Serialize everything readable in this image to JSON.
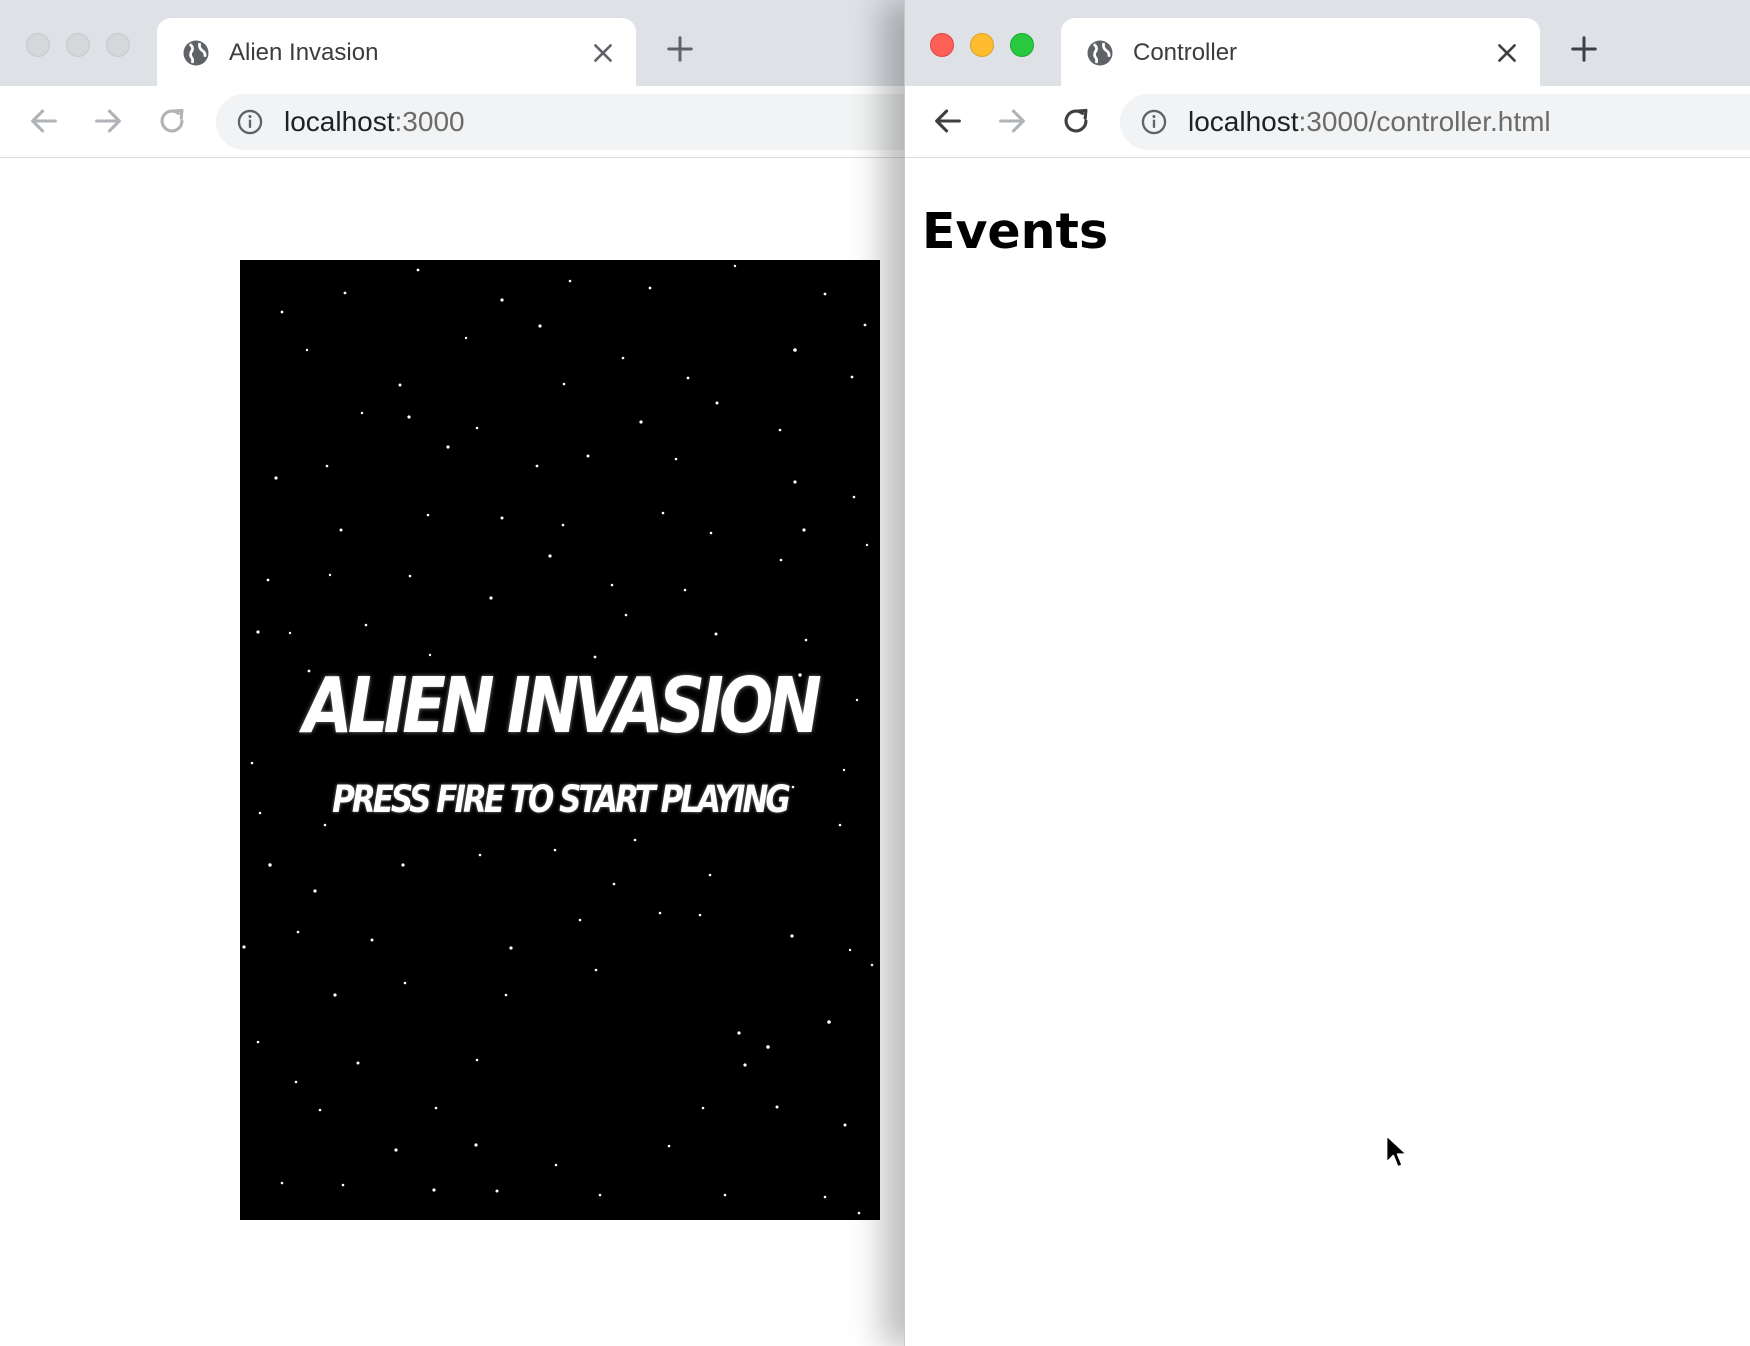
{
  "left_window": {
    "tab": {
      "title": "Alien Invasion",
      "favicon": "globe-icon"
    },
    "url": {
      "host": "localhost",
      "path": ":3000"
    },
    "game": {
      "title": "Alien Invasion",
      "subtitle": "Press fire to start playing",
      "background": "#000000",
      "text_color": "#ffffff"
    }
  },
  "right_window": {
    "tab": {
      "title": "Controller",
      "favicon": "globe-icon"
    },
    "url": {
      "host": "localhost",
      "path": ":3000/controller.html"
    },
    "page": {
      "heading": "Events"
    },
    "traffic_lights": {
      "close": "#fe5f57",
      "minimize": "#febc2e",
      "maximize": "#28c840"
    }
  }
}
